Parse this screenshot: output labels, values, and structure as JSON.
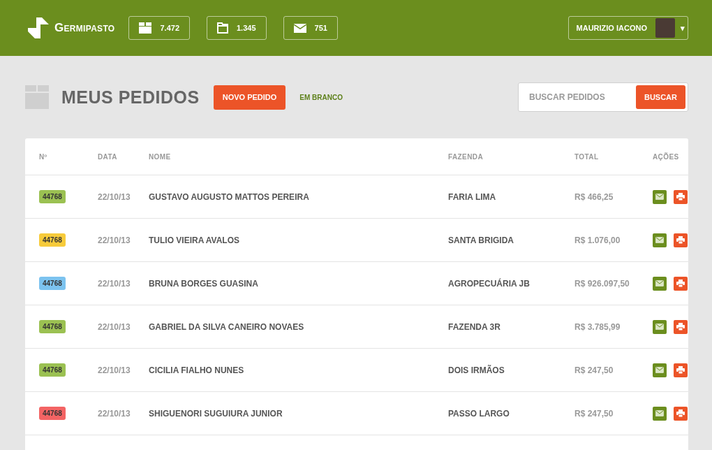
{
  "brand": {
    "name": "Germipasto"
  },
  "counters": [
    {
      "kind": "box",
      "value": "7.472"
    },
    {
      "kind": "folder",
      "value": "1.345"
    },
    {
      "kind": "mail",
      "value": "751"
    }
  ],
  "user": {
    "name": "MAURIZIO IACONO",
    "caret": "▾"
  },
  "page": {
    "title": "MEUS PEDIDOS",
    "new_button": "NOVO PEDIDO",
    "blank_link": "EM BRANCO"
  },
  "search": {
    "placeholder": "BUSCAR PEDIDOS",
    "button": "BUSCAR"
  },
  "table": {
    "columns": [
      "Nº",
      "DATA",
      "NOME",
      "FAZENDA",
      "TOTAL",
      "AÇÕES"
    ],
    "rows": [
      {
        "number": "44768",
        "color": "#9bc152",
        "date": "22/10/13",
        "name": "GUSTAVO AUGUSTO MATTOS PEREIRA",
        "farm": "FARIA LIMA",
        "total": "R$ 466,25"
      },
      {
        "number": "44768",
        "color": "#f7cb3b",
        "date": "22/10/13",
        "name": "TULIO VIEIRA AVALOS",
        "farm": "SANTA BRIGIDA",
        "total": "R$ 1.076,00"
      },
      {
        "number": "44768",
        "color": "#7cc3ef",
        "date": "22/10/13",
        "name": "BRUNA BORGES GUASINA",
        "farm": "AGROPECUÁRIA JB",
        "total": "R$ 926.097,50"
      },
      {
        "number": "44768",
        "color": "#9bc152",
        "date": "22/10/13",
        "name": "GABRIEL DA SILVA CANEIRO NOVAES",
        "farm": "FAZENDA 3R",
        "total": "R$ 3.785,99"
      },
      {
        "number": "44768",
        "color": "#9bc152",
        "date": "22/10/13",
        "name": "CICILIA FIALHO NUNES",
        "farm": "DOIS IRMÃOS",
        "total": "R$ 247,50"
      },
      {
        "number": "44768",
        "color": "#f36464",
        "date": "22/10/13",
        "name": "SHIGUENORI SUGUIURA JUNIOR",
        "farm": "PASSO LARGO",
        "total": "R$ 247,50"
      }
    ]
  }
}
